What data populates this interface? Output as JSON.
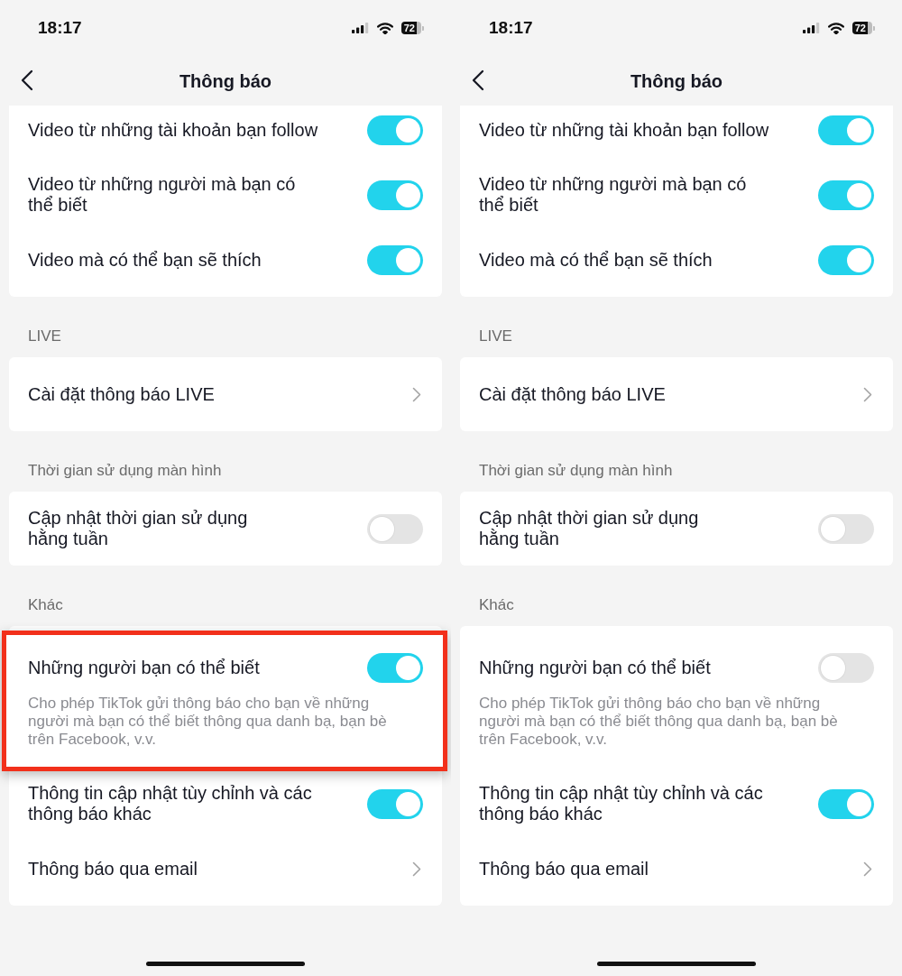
{
  "screens": [
    {
      "status_bar": {
        "time": "18:17",
        "battery": "72"
      },
      "header": {
        "title": "Thông báo"
      },
      "sections": [
        {
          "items": [
            {
              "kind": "toggle",
              "label": "Video từ những tài khoản bạn follow",
              "on": true,
              "highlighted": false
            },
            {
              "kind": "toggle",
              "label": "Video từ những người mà bạn có\nthể biết",
              "on": true,
              "highlighted": false
            },
            {
              "kind": "toggle",
              "label": "Video mà có thể bạn sẽ thích",
              "on": true,
              "highlighted": false
            }
          ]
        },
        {
          "title": "LIVE",
          "items": [
            {
              "kind": "link",
              "label": "Cài đặt thông báo LIVE",
              "highlighted": false
            }
          ]
        },
        {
          "title": "Thời gian sử dụng màn hình",
          "items": [
            {
              "kind": "toggle",
              "label": "Cập nhật thời gian sử dụng\nhằng tuần",
              "on": false,
              "highlighted": false
            }
          ]
        },
        {
          "title": "Khác",
          "items": [
            {
              "kind": "toggle",
              "label": "Những người bạn có thể biết",
              "description": "Cho phép TikTok gửi thông báo cho bạn về những\nngười mà bạn có thể biết thông qua danh bạ, bạn bè\ntrên Facebook, v.v.",
              "on": true,
              "highlighted": true
            },
            {
              "kind": "toggle",
              "label": "Thông tin cập nhật tùy chỉnh và các\nthông báo khác",
              "on": true,
              "highlighted": false
            },
            {
              "kind": "link",
              "label": "Thông báo qua email",
              "highlighted": false
            }
          ]
        }
      ]
    },
    {
      "status_bar": {
        "time": "18:17",
        "battery": "72"
      },
      "header": {
        "title": "Thông báo"
      },
      "sections": [
        {
          "items": [
            {
              "kind": "toggle",
              "label": "Video từ những tài khoản bạn follow",
              "on": true,
              "highlighted": false
            },
            {
              "kind": "toggle",
              "label": "Video từ những người mà bạn có\nthể biết",
              "on": true,
              "highlighted": false
            },
            {
              "kind": "toggle",
              "label": "Video mà có thể bạn sẽ thích",
              "on": true,
              "highlighted": false
            }
          ]
        },
        {
          "title": "LIVE",
          "items": [
            {
              "kind": "link",
              "label": "Cài đặt thông báo LIVE",
              "highlighted": false
            }
          ]
        },
        {
          "title": "Thời gian sử dụng màn hình",
          "items": [
            {
              "kind": "toggle",
              "label": "Cập nhật thời gian sử dụng\nhằng tuần",
              "on": false,
              "highlighted": false
            }
          ]
        },
        {
          "title": "Khác",
          "items": [
            {
              "kind": "toggle",
              "label": "Những người bạn có thể biết",
              "description": "Cho phép TikTok gửi thông báo cho bạn về những\nngười mà bạn có thể biết thông qua danh bạ, bạn bè\ntrên Facebook, v.v.",
              "on": false,
              "highlighted": false
            },
            {
              "kind": "toggle",
              "label": "Thông tin cập nhật tùy chỉnh và các\nthông báo khác",
              "on": true,
              "highlighted": false
            },
            {
              "kind": "link",
              "label": "Thông báo qua email",
              "highlighted": false
            }
          ]
        }
      ]
    }
  ]
}
